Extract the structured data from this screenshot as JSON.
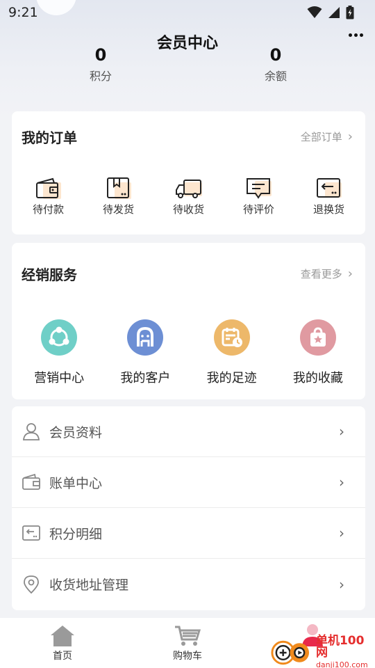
{
  "status_bar": {
    "time": "9:21"
  },
  "header": {
    "title": "会员中心"
  },
  "stats": [
    {
      "value": "0",
      "label": "积分"
    },
    {
      "value": "0",
      "label": "余额"
    }
  ],
  "orders": {
    "title": "我的订单",
    "link": "全部订单",
    "items": [
      {
        "label": "待付款",
        "icon": "wallet-icon"
      },
      {
        "label": "待发货",
        "icon": "package-icon"
      },
      {
        "label": "待收货",
        "icon": "truck-icon"
      },
      {
        "label": "待评价",
        "icon": "comment-icon"
      },
      {
        "label": "退换货",
        "icon": "return-icon"
      }
    ]
  },
  "services": {
    "title": "经销服务",
    "link": "查看更多",
    "items": [
      {
        "label": "营销中心",
        "icon": "share-icon",
        "color": "#6fcfc7"
      },
      {
        "label": "我的客户",
        "icon": "customer-icon",
        "color": "#6d8fd4"
      },
      {
        "label": "我的足迹",
        "icon": "calendar-clock-icon",
        "color": "#edb86a"
      },
      {
        "label": "我的收藏",
        "icon": "favorite-bag-icon",
        "color": "#e09aa1"
      }
    ]
  },
  "menu": [
    {
      "label": "会员资料",
      "icon": "user-icon"
    },
    {
      "label": "账单中心",
      "icon": "wallet-icon"
    },
    {
      "label": "积分明细",
      "icon": "points-icon"
    },
    {
      "label": "收货地址管理",
      "icon": "location-icon"
    }
  ],
  "tabbar": [
    {
      "label": "首页",
      "icon": "home-icon"
    },
    {
      "label": "购物车",
      "icon": "cart-icon"
    },
    {
      "label": "",
      "icon": "user-icon"
    }
  ],
  "watermark": {
    "line1": "单机100网",
    "line2": "danji100.com"
  },
  "colors": {
    "accent_orange": "#f5a15b",
    "icon_dark": "#222222",
    "page_bg": "#f2f3f6"
  }
}
